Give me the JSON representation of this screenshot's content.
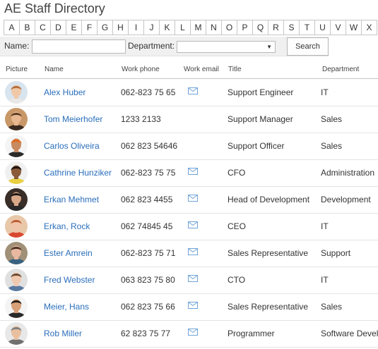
{
  "title": "AE Staff Directory",
  "letters": [
    "A",
    "B",
    "C",
    "D",
    "E",
    "F",
    "G",
    "H",
    "I",
    "J",
    "K",
    "L",
    "M",
    "N",
    "O",
    "P",
    "Q",
    "R",
    "S",
    "T",
    "U",
    "V",
    "W",
    "X"
  ],
  "filter": {
    "name_label": "Name:",
    "name_value": "",
    "department_label": "Department:",
    "department_value": "",
    "search_label": "Search"
  },
  "columns": {
    "picture": "Picture",
    "name": "Name",
    "work_phone": "Work phone",
    "work_email": "Work email",
    "title": "Title",
    "department": "Department"
  },
  "icons": {
    "email": "mail-icon"
  },
  "colors": {
    "link": "#2a6ebb",
    "email_icon": "#6fa3d8"
  },
  "rows": [
    {
      "name": "Alex Huber",
      "phone": "062-823 75 65",
      "email": true,
      "title": "Support Engineer",
      "department": "IT",
      "skin": "#f0c8a8",
      "hair": "#b07040",
      "shirt": "#e8e8e8",
      "bg": "#d8e4ee"
    },
    {
      "name": "Tom Meierhofer",
      "phone": "1233 2133",
      "email": false,
      "title": "Support Manager",
      "department": "Sales",
      "skin": "#e8b890",
      "hair": "#5a3c22",
      "shirt": "#3a2a20",
      "bg": "#c89868"
    },
    {
      "name": "Carlos Oliveira",
      "phone": "062 823 54646",
      "email": false,
      "title": "Support Officer",
      "department": "Sales",
      "skin": "#c88a60",
      "hair": "#e06a1a",
      "shirt": "#2a2a2a",
      "bg": "#f4f4f4"
    },
    {
      "name": "Cathrine Hunziker",
      "phone": "062-823 75 75",
      "email": true,
      "title": "CFO",
      "department": "Administration",
      "skin": "#8a5a3a",
      "hair": "#1a1210",
      "shirt": "#e8d040",
      "bg": "#f0f0f0"
    },
    {
      "name": "Erkan Mehmet",
      "phone": "062 823 4455",
      "email": true,
      "title": "Head of Development",
      "department": "Development",
      "skin": "#d8a888",
      "hair": "#1a1614",
      "shirt": "#282828",
      "bg": "#3a2e28"
    },
    {
      "name": "Erkan, Rock",
      "phone": "062 74845 45",
      "email": true,
      "title": "CEO",
      "department": "IT",
      "skin": "#f0c4a8",
      "hair": "#b85a30",
      "shirt": "#d84830",
      "bg": "#e8c8a8"
    },
    {
      "name": "Ester Amrein",
      "phone": "062-823 75 71",
      "email": true,
      "title": "Sales Representative",
      "department": "Support",
      "skin": "#e8b8a0",
      "hair": "#4a3020",
      "shirt": "#386080",
      "bg": "#a09078"
    },
    {
      "name": "Fred Webster",
      "phone": "063 823 75 80",
      "email": true,
      "title": "CTO",
      "department": "IT",
      "skin": "#f0c8b0",
      "hair": "#6a4a30",
      "shirt": "#5878a0",
      "bg": "#e0e0e0"
    },
    {
      "name": "Meier, Hans",
      "phone": "062 823 75 66",
      "email": true,
      "title": "Sales Representative",
      "department": "Sales",
      "skin": "#d8a078",
      "hair": "#241a14",
      "shirt": "#2a2a2a",
      "bg": "#f4f4f4"
    },
    {
      "name": "Rob Miller",
      "phone": "62 823 75 77",
      "email": true,
      "title": "Programmer",
      "department": "Software Devel",
      "skin": "#e8c0a0",
      "hair": "#808080",
      "shirt": "#707070",
      "bg": "#e8e8e8"
    }
  ]
}
